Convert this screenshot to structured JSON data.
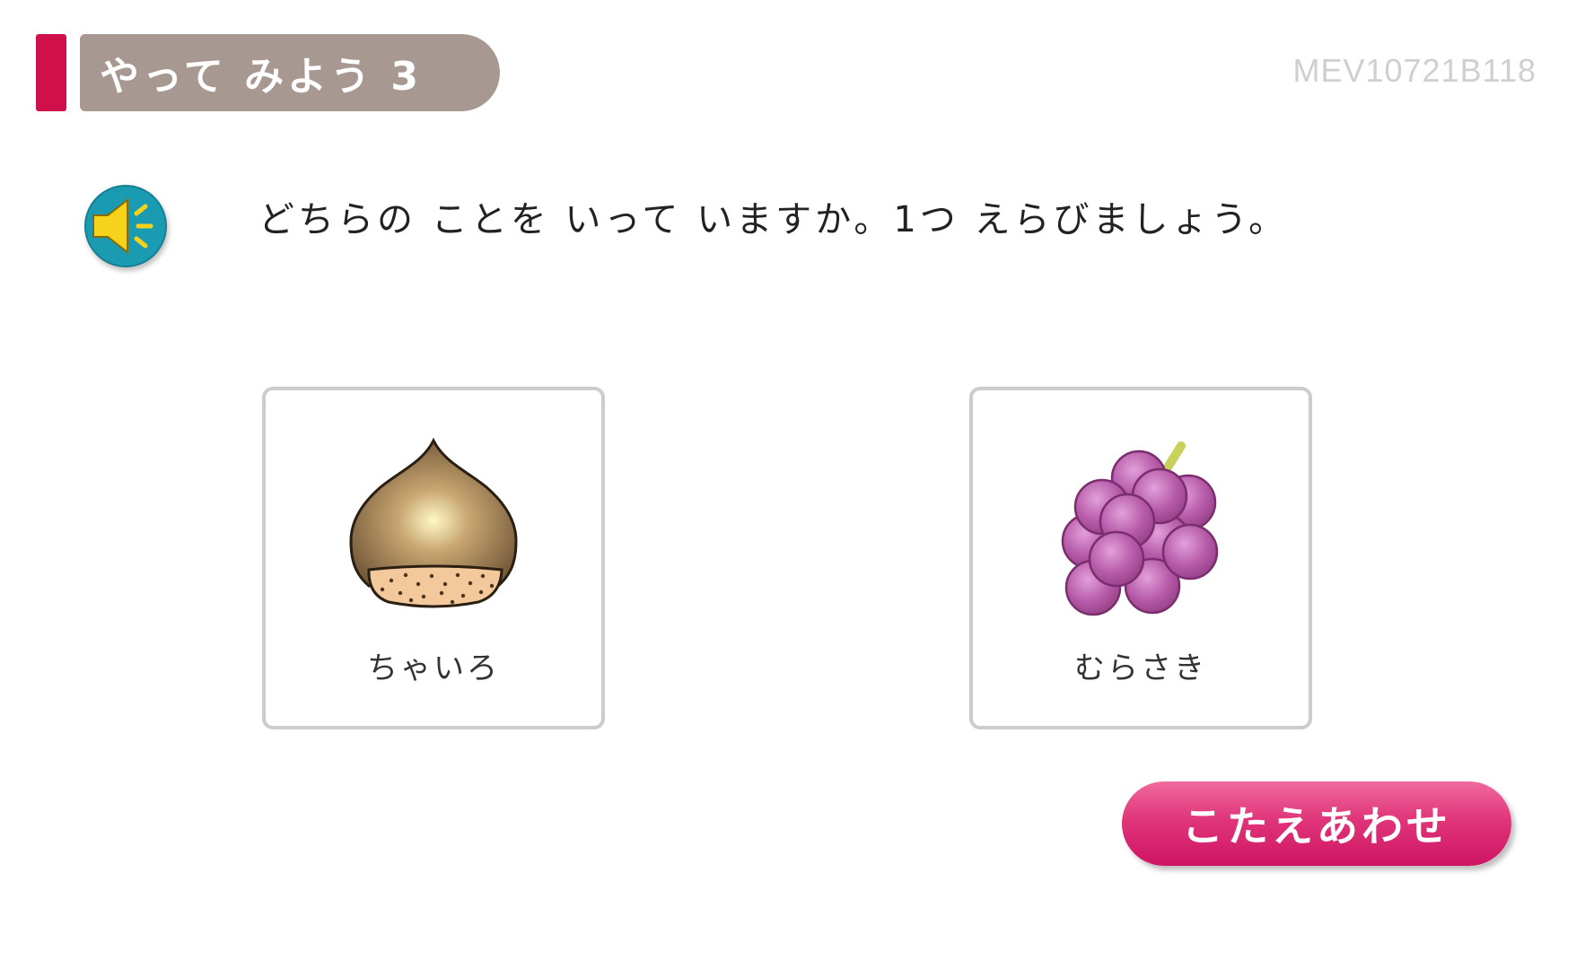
{
  "header": {
    "title": "やって みよう 3",
    "accent_color": "#d0104a",
    "pill_color": "#a79991"
  },
  "code": "MEV10721B118",
  "audio": {
    "icon": "speaker-icon"
  },
  "question": "どちらの ことを いって いますか。1つ えらびましょう。",
  "choices": [
    {
      "label": "ちゃいろ",
      "icon": "chestnut-icon"
    },
    {
      "label": "むらさき",
      "icon": "grapes-icon"
    }
  ],
  "answer_button": {
    "label": "こたえあわせ",
    "color": "#e0357a"
  }
}
